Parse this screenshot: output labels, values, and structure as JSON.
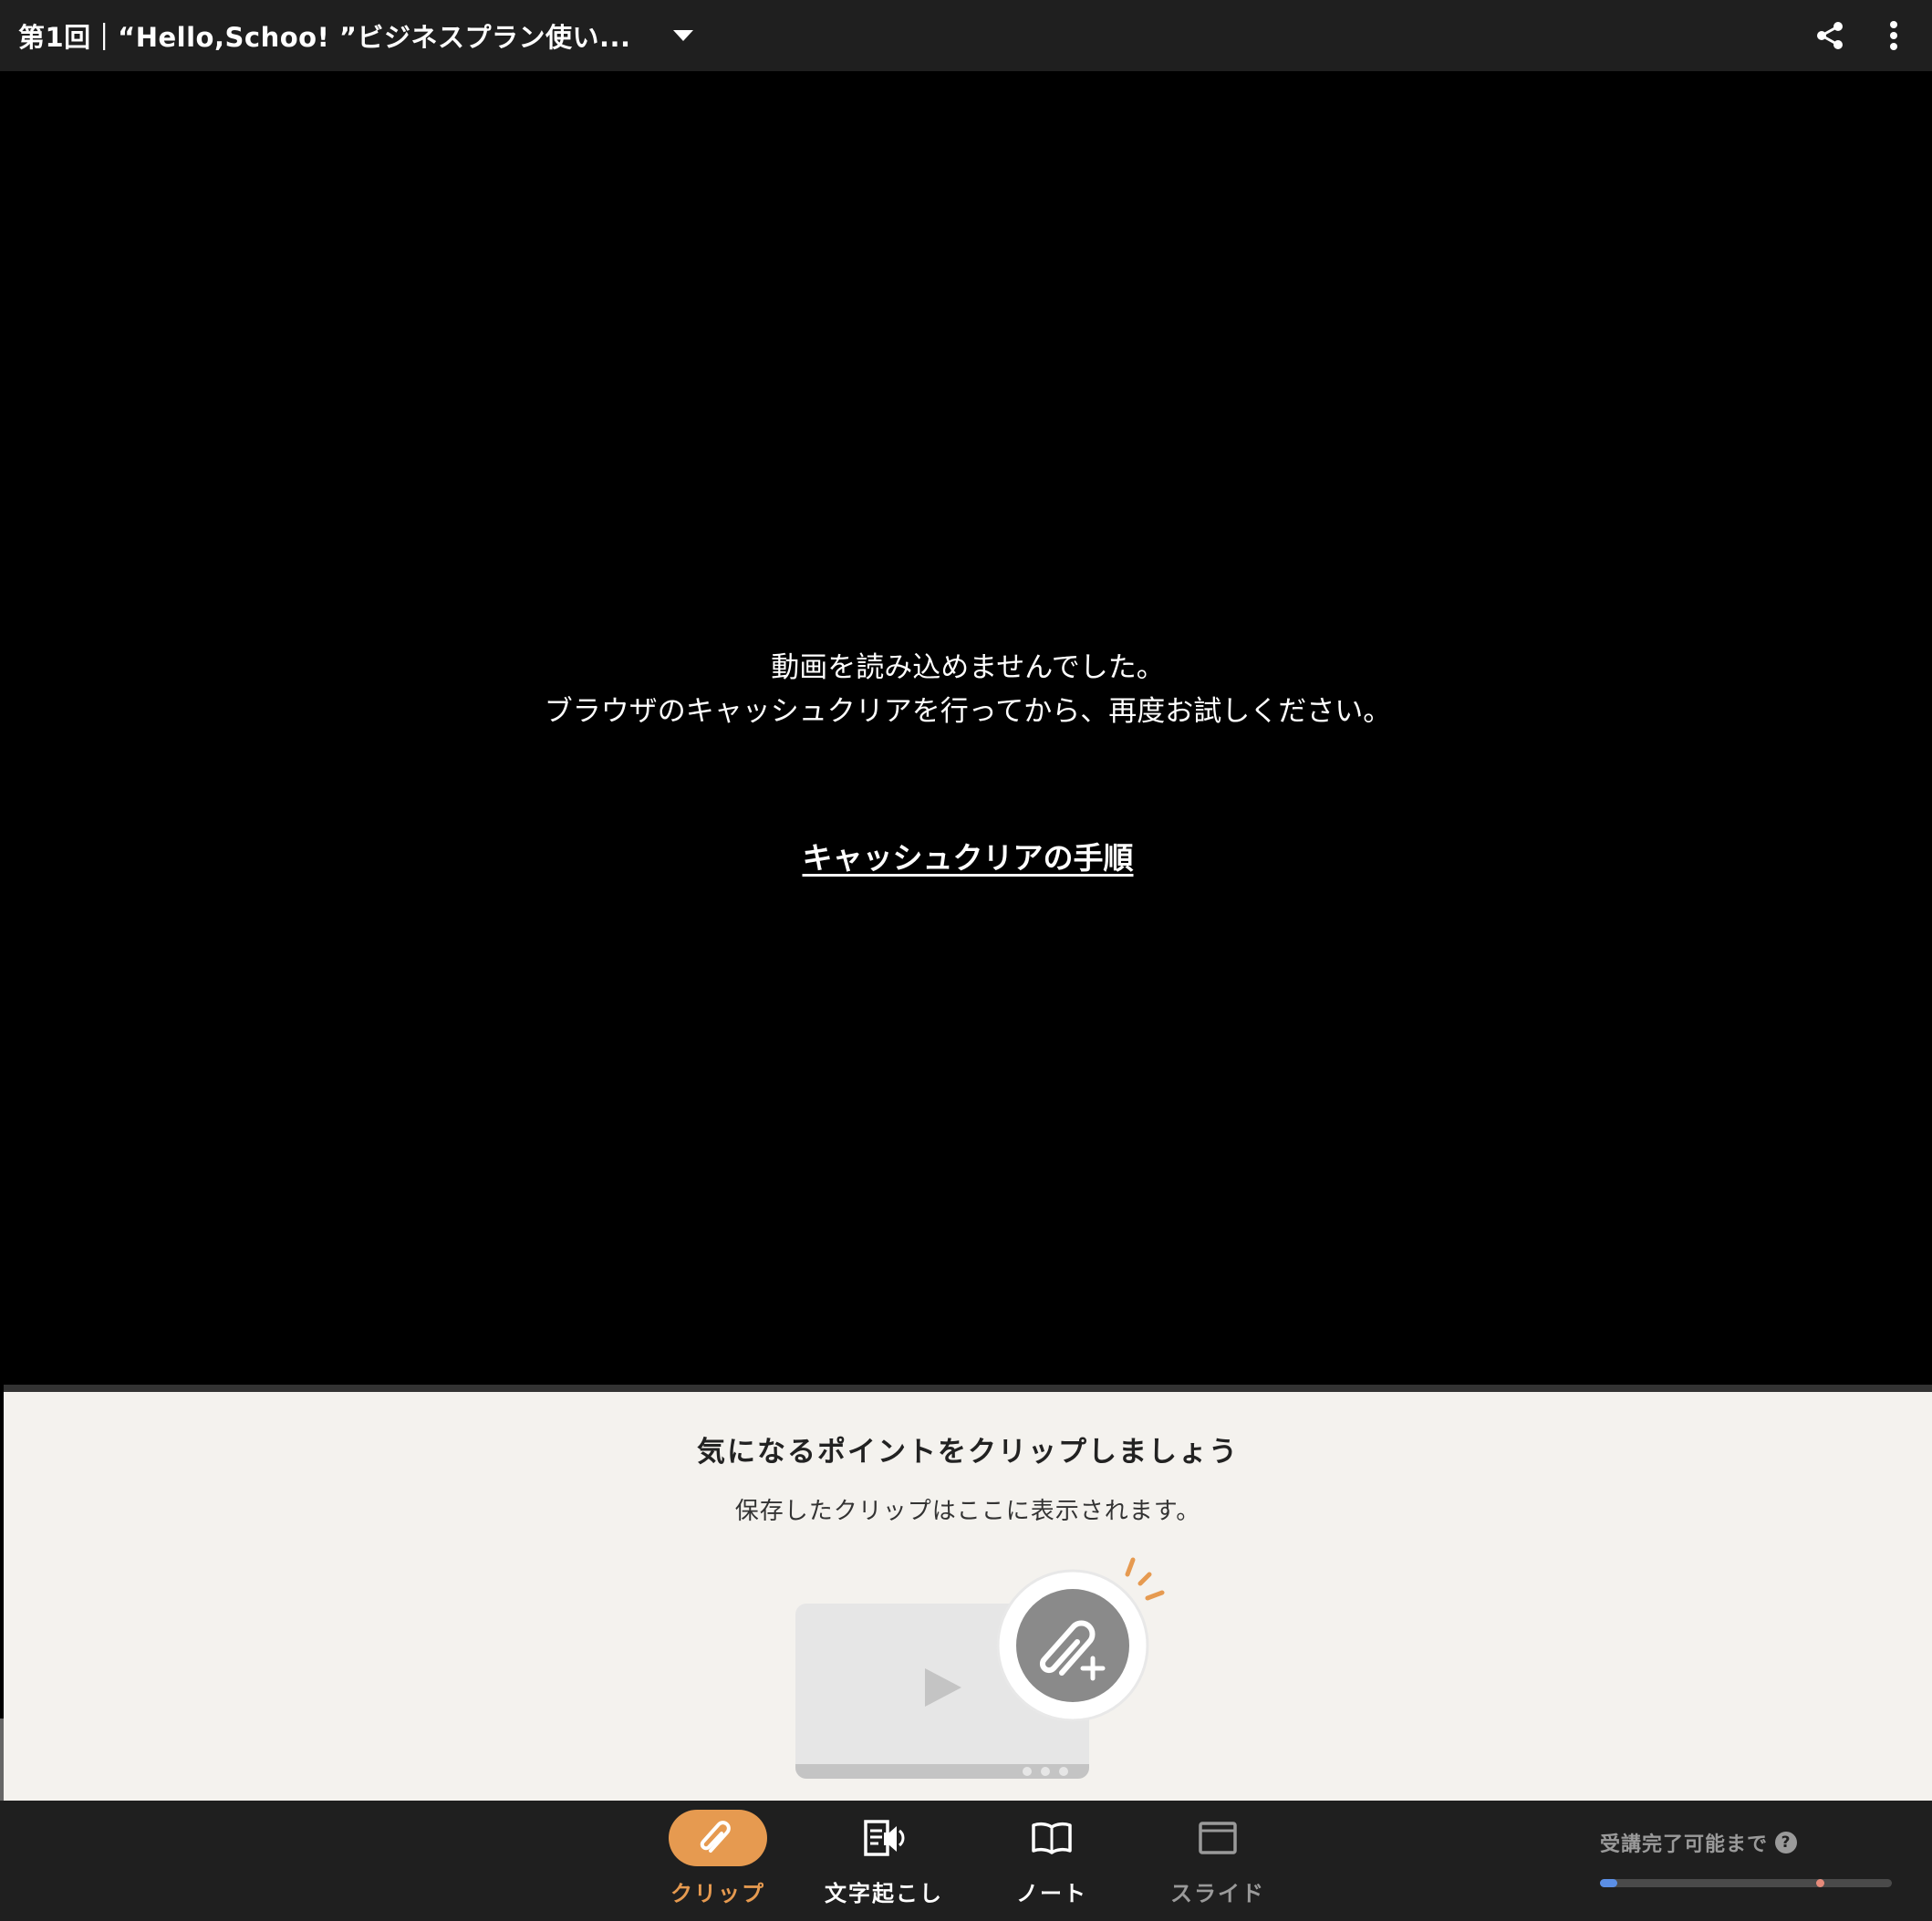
{
  "header": {
    "title": "第1回｜“Hello,Schoo! ”ビジネスプラン使い...",
    "icons": {
      "dropdown": "caret-down-icon",
      "share": "share-icon",
      "more": "more-vertical-icon"
    }
  },
  "video": {
    "error_line1": "動画を読み込めませんでした。",
    "error_line2": "ブラウザのキャッシュクリアを行ってから、再度お試しください。",
    "help_link": "キャッシュクリアの手順"
  },
  "clip_panel": {
    "title": "気になるポイントをクリップしましょう",
    "subtitle": "保存したクリップはここに表示されます。"
  },
  "bottom_nav": {
    "items": [
      {
        "label": "クリップ",
        "icon": "clip-icon",
        "state": "active"
      },
      {
        "label": "文字起こし",
        "icon": "transcript-icon",
        "state": "normal"
      },
      {
        "label": "ノート",
        "icon": "note-book-icon",
        "state": "normal"
      },
      {
        "label": "スライド",
        "icon": "slide-icon",
        "state": "dim"
      }
    ]
  },
  "progress": {
    "label": "受講完了可能まで",
    "help": "?",
    "fill_fraction": 0.06,
    "marker_fraction": 0.74
  },
  "colors": {
    "accent": "#e69a50",
    "bar_bg": "#1f1f1f",
    "panel_bg": "#f4f2ee",
    "progress_fill": "#5b8fe6",
    "progress_marker": "#e58a7a"
  }
}
